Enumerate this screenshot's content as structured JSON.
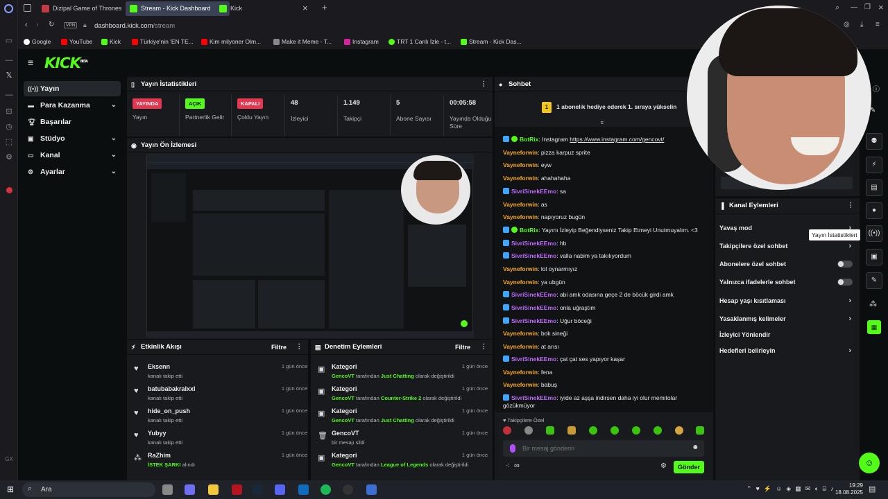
{
  "browser": {
    "tabs": [
      {
        "label": "Dizipal Game of Thrones"
      },
      {
        "label": "Stream - Kick Dashboard"
      },
      {
        "label": "Kick"
      }
    ],
    "vpn_label": "VPN",
    "url_domain": "dashboard.kick.com",
    "url_path": "/stream",
    "bookmarks": [
      {
        "label": "Google"
      },
      {
        "label": "YouTube"
      },
      {
        "label": "Kick"
      },
      {
        "label": "Türkiye'nin 'EN TE..."
      },
      {
        "label": "Kim milyoner Olm..."
      },
      {
        "label": "Make it Meme - T..."
      },
      {
        "label": "Instagram"
      },
      {
        "label": "TRT 1 Canlı İzle - t..."
      },
      {
        "label": "Stream - Kick Das..."
      }
    ],
    "rail_badge": "GX"
  },
  "kick": {
    "logo": "KICK",
    "logo_tag": "BETA"
  },
  "sidebar": {
    "items": [
      {
        "label": "Yayın",
        "icon": "broadcast-icon"
      },
      {
        "label": "Para Kazanma",
        "icon": "money-icon"
      },
      {
        "label": "Başarılar",
        "icon": "trophy-icon"
      },
      {
        "label": "Stüdyo",
        "icon": "studio-icon"
      },
      {
        "label": "Kanal",
        "icon": "channel-icon"
      },
      {
        "label": "Ayarlar",
        "icon": "gear-icon"
      }
    ]
  },
  "stats": {
    "title": "Yayın İstatistikleri",
    "items": [
      {
        "badge": "YAYINDA",
        "label": "Yayın",
        "badge_color": "#e5374f"
      },
      {
        "badge": "AÇIK",
        "label": "Partnerlik Gelir",
        "badge_color": "#53fc18"
      },
      {
        "badge": "KAPALI",
        "label": "Çoklu Yayın",
        "badge_color": "#e5374f"
      },
      {
        "value": "48",
        "label": "İzleyici"
      },
      {
        "value": "1.149",
        "label": "Takipçi"
      },
      {
        "value": "5",
        "label": "Abone Sayısı"
      },
      {
        "value": "00:05:58",
        "label": "Yayında Olduğu Süre"
      }
    ]
  },
  "preview": {
    "title": "Yayın Ön İzlemesi"
  },
  "activity": {
    "title": "Etkinlik Akışı",
    "filter": "Filtre",
    "rows": [
      {
        "name": "Eksenn",
        "sub": "kanalı takip etti",
        "time": "1 gün önce"
      },
      {
        "name": "batubabakralxxl",
        "sub": "kanalı takip etti",
        "time": "1 gün önce"
      },
      {
        "name": "hide_on_push",
        "sub": "kanalı takip etti",
        "time": "1 gün önce"
      },
      {
        "name": "Yubyy",
        "sub": "kanalı takip etti",
        "time": "1 gün önce"
      },
      {
        "name": "RaZhim",
        "sub_hl": "İSTEK ŞARKI",
        "sub": "alındı",
        "time": "1 gün önce"
      }
    ]
  },
  "moderation": {
    "title": "Denetim Eylemleri",
    "filter": "Filtre",
    "rows": [
      {
        "name": "Kategori",
        "actor": "GencoVT",
        "mid": "tarafından",
        "value": "Just Chatting",
        "end": "olarak değiştirildi",
        "time": "1 gün önce"
      },
      {
        "name": "Kategori",
        "actor": "GencoVT",
        "mid": "tarafından",
        "value": "Counter-Strike 2",
        "end": "olarak değiştirildi",
        "time": "1 gün önce"
      },
      {
        "name": "Kategori",
        "actor": "GencoVT",
        "mid": "tarafından",
        "value": "Just Chatting",
        "end": "olarak değiştirildi",
        "time": "1 gün önce"
      },
      {
        "name": "GencoVT",
        "actor": "",
        "mid": "bir mesajı sildi",
        "value": "",
        "end": "",
        "time": "1 gün önce"
      },
      {
        "name": "Kategori",
        "actor": "GencoVT",
        "mid": "tarafından",
        "value": "League of Legends",
        "end": "olarak değiştirildi",
        "time": "1 gün önce"
      }
    ]
  },
  "chat": {
    "title": "Sohbet",
    "pinned_count": "1",
    "pinned": "1 abonelik hediye ederek 1. sıraya yükselin",
    "messages": [
      {
        "user": "BotRix",
        "color": "green",
        "text": "Instagram ",
        "link": "https://www.instagram.com/gencovt/"
      },
      {
        "user": "Vayneforwin",
        "color": "orange",
        "text": "pizza karpuz sprite"
      },
      {
        "user": "Vayneforwin",
        "color": "orange",
        "text": "eyw"
      },
      {
        "user": "Vayneforwin",
        "color": "orange",
        "text": "ahahahaha"
      },
      {
        "user": "SivriSinekEEmo",
        "color": "purple",
        "text": "sa"
      },
      {
        "user": "Vayneforwin",
        "color": "orange",
        "text": "as"
      },
      {
        "user": "Vayneforwin",
        "color": "orange",
        "text": "napıyoruz bugün"
      },
      {
        "user": "BotRix",
        "color": "green",
        "text": "Yayını İzleyip Beğendiyseniz Takip Etmeyi Unutmuyalım. <3"
      },
      {
        "user": "SivriSinekEEmo",
        "color": "purple",
        "text": "hb"
      },
      {
        "user": "SivriSinekEEmo",
        "color": "purple",
        "text": "valla nabim ya takılıyordum"
      },
      {
        "user": "Vayneforwin",
        "color": "orange",
        "text": "lol oynarmıyız"
      },
      {
        "user": "Vayneforwin",
        "color": "orange",
        "text": "ya ubgün"
      },
      {
        "user": "SivriSinekEEmo",
        "color": "purple",
        "text": "abi amk odasına geçe 2 de böcük girdi amk"
      },
      {
        "user": "SivriSinekEEmo",
        "color": "purple",
        "text": "onla uğraştım"
      },
      {
        "user": "SivriSinekEEmo",
        "color": "purple",
        "text": "Uğur böceği"
      },
      {
        "user": "Vayneforwin",
        "color": "orange",
        "text": "bok sineği"
      },
      {
        "user": "Vayneforwin",
        "color": "orange",
        "text": "at arısı"
      },
      {
        "user": "SivriSinekEEmo",
        "color": "purple",
        "text": "çat çat ses yapıyor kaşar"
      },
      {
        "user": "Vayneforwin",
        "color": "orange",
        "text": "fena"
      },
      {
        "user": "Vayneforwin",
        "color": "orange",
        "text": "babuş"
      },
      {
        "user": "SivriSinekEEmo",
        "color": "purple",
        "text": "iyide az aşşa indirsen daha iyi olur memitolar gözükmüyor"
      }
    ],
    "followers_only": "Takipçilere Özel",
    "input_placeholder": "Bir mesaj gönderin",
    "send": "Gönder",
    "infinity": "∞"
  },
  "channel_actions": {
    "title": "Kanal Eylemleri",
    "rows": [
      {
        "label": "Yavaş mod",
        "kind": "arrow"
      },
      {
        "label": "Takipçilere özel sohbet",
        "kind": "arrow"
      },
      {
        "label": "Abonelere özel sohbet",
        "kind": "toggle"
      },
      {
        "label": "Yalnızca ifadelerle sohbet",
        "kind": "toggle"
      },
      {
        "label": "Hesap yaşı kısıtlaması",
        "kind": "arrow"
      },
      {
        "label": "Yasaklanmış kelimeler",
        "kind": "arrow"
      },
      {
        "label": "İzleyici Yönlendir",
        "kind": "none"
      },
      {
        "label": "Hedefleri belirleyin",
        "kind": "arrow"
      }
    ],
    "tooltip": "Yayın İstatistikleri"
  },
  "taskbar": {
    "search": "Ara",
    "time": "19:29",
    "date": "18.08.2025"
  },
  "colors": {
    "accent": "#53fc18",
    "live": "#e5374f",
    "panel": "#181a1d",
    "bg": "#0b0e0f"
  }
}
